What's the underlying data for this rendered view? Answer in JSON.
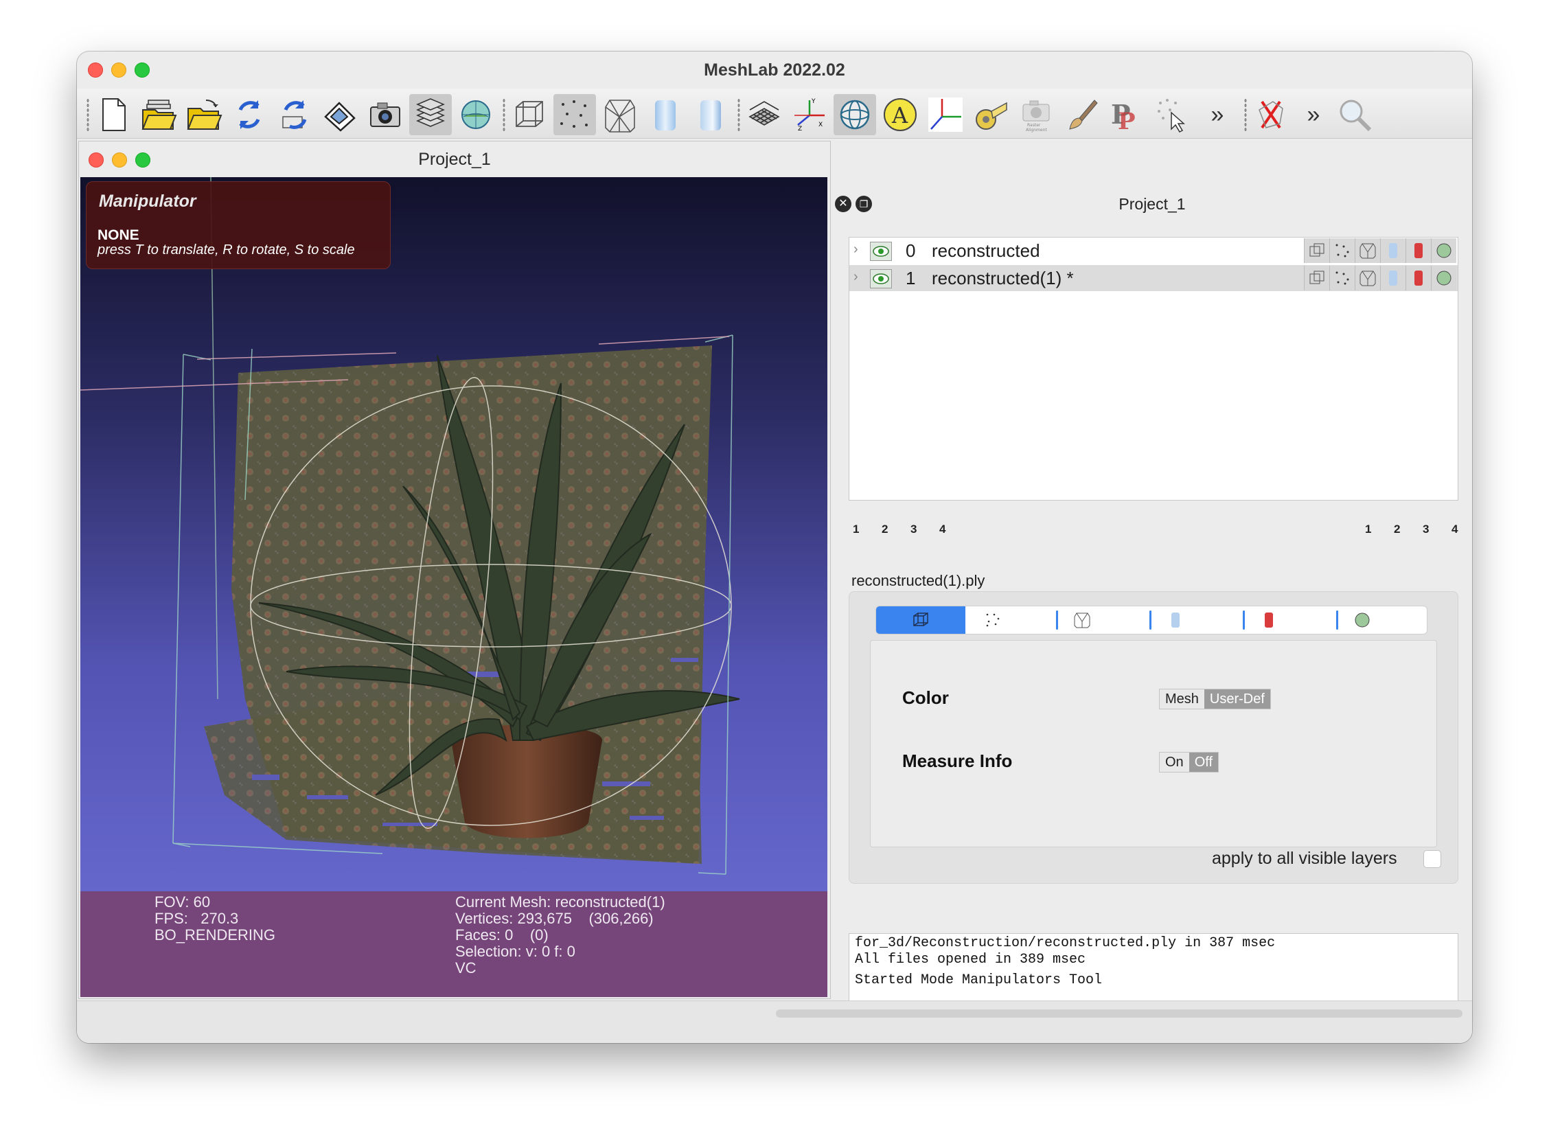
{
  "app": {
    "window_title": "MeshLab 2022.02"
  },
  "toolbar": {
    "icons": [
      "new-project-icon",
      "open-project-icon",
      "import-mesh-icon",
      "reload-icon",
      "reload-all-icon",
      "save-icon",
      "snapshot-icon",
      "layers-icon",
      "raster-icon",
      "bounding-box-icon",
      "points-icon",
      "wireframe-icon",
      "flat-icon",
      "smooth-icon",
      "grid-icon",
      "axes-icon",
      "manipulator-icon",
      "annotation-icon",
      "align-icon",
      "measure-icon",
      "raster-alignment-icon",
      "paint-icon",
      "pickpoints-icon",
      "select-icon",
      "more-icon",
      "delete-icon",
      "more-icon",
      "search-icon"
    ]
  },
  "viewer": {
    "title": "Project_1",
    "manipulator": {
      "title": "Manipulator",
      "mode": "NONE",
      "help": "press T to translate, R to rotate, S to scale"
    },
    "info_left": [
      "FOV: 60",
      "FPS:   270.3",
      "BO_RENDERING"
    ],
    "info_right": [
      "Current Mesh: reconstructed(1)",
      "Vertices: 293,675    (306,266)",
      "Faces: 0    (0)",
      "Selection: v: 0 f: 0",
      "VC"
    ]
  },
  "right_panel": {
    "title": "Project_1",
    "layers": [
      {
        "index": "0",
        "name": "reconstructed"
      },
      {
        "index": "1",
        "name": "reconstructed(1) *"
      }
    ],
    "pages_left": [
      "1",
      "2",
      "3",
      "4"
    ],
    "pages_right": [
      "1",
      "2",
      "3",
      "4"
    ],
    "file_label": "reconstructed(1).ply",
    "props": {
      "color_label": "Color",
      "color_options": [
        "Mesh",
        "User-Def"
      ],
      "measure_label": "Measure Info",
      "measure_options": [
        "On",
        "Off"
      ],
      "apply_label": "apply to all visible layers"
    },
    "log": [
      "for_3d/Reconstruction/reconstructed.ply in 387 msec",
      "All files opened in 389 msec",
      "Started Mode Manipulators Tool"
    ]
  },
  "colors": {
    "accent": "#3a84f0",
    "info_bar": "#76467a",
    "manipulator_bg": "#4a1212"
  }
}
